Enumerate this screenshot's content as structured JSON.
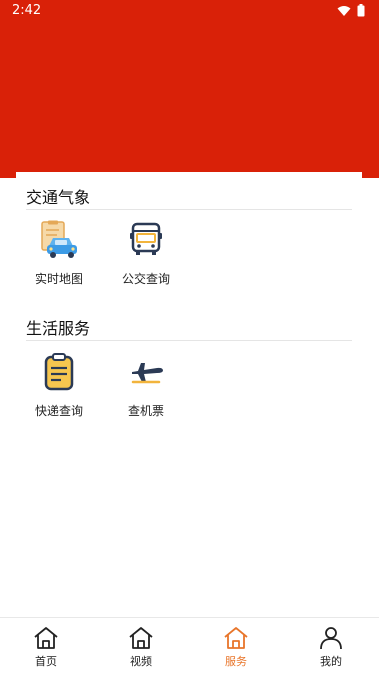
{
  "status_bar": {
    "time": "2:42"
  },
  "sections": [
    {
      "title": "交通气象",
      "items": [
        {
          "label": "实时地图",
          "icon": "car-map-icon"
        },
        {
          "label": "公交查询",
          "icon": "bus-icon"
        }
      ]
    },
    {
      "title": "生活服务",
      "items": [
        {
          "label": "快递查询",
          "icon": "clipboard-icon"
        },
        {
          "label": "查机票",
          "icon": "airplane-icon"
        }
      ]
    }
  ],
  "bottom_nav": [
    {
      "label": "首页",
      "icon": "home-icon",
      "active": false
    },
    {
      "label": "视频",
      "icon": "video-home-icon",
      "active": false
    },
    {
      "label": "服务",
      "icon": "service-home-icon",
      "active": true
    },
    {
      "label": "我的",
      "icon": "profile-icon",
      "active": false
    }
  ],
  "colors": {
    "header_red": "#d92108",
    "active_orange": "#e8752a"
  }
}
